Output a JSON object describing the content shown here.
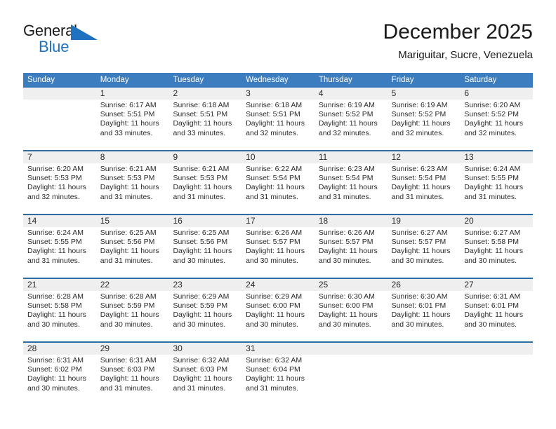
{
  "brand": {
    "name_top": "General",
    "name_bottom": "Blue",
    "mark": "triangle-logo",
    "color_top": "#1a1a1a",
    "color_bottom": "#1f72c0",
    "mark_color": "#1f72c0"
  },
  "header": {
    "title": "December 2025",
    "subtitle": "Mariguitar, Sucre, Venezuela"
  },
  "theme": {
    "header_bg": "#3b7dbf",
    "header_text": "#ffffff",
    "week_divider": "#2e6da4",
    "daynum_band": "#efefef",
    "body_text": "#2a2a2a"
  },
  "weekdays": [
    "Sunday",
    "Monday",
    "Tuesday",
    "Wednesday",
    "Thursday",
    "Friday",
    "Saturday"
  ],
  "weeks": [
    {
      "days": [
        {
          "date": "",
          "sunrise": "",
          "sunset": "",
          "daylight_1": "",
          "daylight_2": "",
          "empty": true
        },
        {
          "date": "1",
          "sunrise": "Sunrise: 6:17 AM",
          "sunset": "Sunset: 5:51 PM",
          "daylight_1": "Daylight: 11 hours",
          "daylight_2": "and 33 minutes."
        },
        {
          "date": "2",
          "sunrise": "Sunrise: 6:18 AM",
          "sunset": "Sunset: 5:51 PM",
          "daylight_1": "Daylight: 11 hours",
          "daylight_2": "and 33 minutes."
        },
        {
          "date": "3",
          "sunrise": "Sunrise: 6:18 AM",
          "sunset": "Sunset: 5:51 PM",
          "daylight_1": "Daylight: 11 hours",
          "daylight_2": "and 32 minutes."
        },
        {
          "date": "4",
          "sunrise": "Sunrise: 6:19 AM",
          "sunset": "Sunset: 5:52 PM",
          "daylight_1": "Daylight: 11 hours",
          "daylight_2": "and 32 minutes."
        },
        {
          "date": "5",
          "sunrise": "Sunrise: 6:19 AM",
          "sunset": "Sunset: 5:52 PM",
          "daylight_1": "Daylight: 11 hours",
          "daylight_2": "and 32 minutes."
        },
        {
          "date": "6",
          "sunrise": "Sunrise: 6:20 AM",
          "sunset": "Sunset: 5:52 PM",
          "daylight_1": "Daylight: 11 hours",
          "daylight_2": "and 32 minutes."
        }
      ]
    },
    {
      "days": [
        {
          "date": "7",
          "sunrise": "Sunrise: 6:20 AM",
          "sunset": "Sunset: 5:53 PM",
          "daylight_1": "Daylight: 11 hours",
          "daylight_2": "and 32 minutes."
        },
        {
          "date": "8",
          "sunrise": "Sunrise: 6:21 AM",
          "sunset": "Sunset: 5:53 PM",
          "daylight_1": "Daylight: 11 hours",
          "daylight_2": "and 31 minutes."
        },
        {
          "date": "9",
          "sunrise": "Sunrise: 6:21 AM",
          "sunset": "Sunset: 5:53 PM",
          "daylight_1": "Daylight: 11 hours",
          "daylight_2": "and 31 minutes."
        },
        {
          "date": "10",
          "sunrise": "Sunrise: 6:22 AM",
          "sunset": "Sunset: 5:54 PM",
          "daylight_1": "Daylight: 11 hours",
          "daylight_2": "and 31 minutes."
        },
        {
          "date": "11",
          "sunrise": "Sunrise: 6:23 AM",
          "sunset": "Sunset: 5:54 PM",
          "daylight_1": "Daylight: 11 hours",
          "daylight_2": "and 31 minutes."
        },
        {
          "date": "12",
          "sunrise": "Sunrise: 6:23 AM",
          "sunset": "Sunset: 5:54 PM",
          "daylight_1": "Daylight: 11 hours",
          "daylight_2": "and 31 minutes."
        },
        {
          "date": "13",
          "sunrise": "Sunrise: 6:24 AM",
          "sunset": "Sunset: 5:55 PM",
          "daylight_1": "Daylight: 11 hours",
          "daylight_2": "and 31 minutes."
        }
      ]
    },
    {
      "days": [
        {
          "date": "14",
          "sunrise": "Sunrise: 6:24 AM",
          "sunset": "Sunset: 5:55 PM",
          "daylight_1": "Daylight: 11 hours",
          "daylight_2": "and 31 minutes."
        },
        {
          "date": "15",
          "sunrise": "Sunrise: 6:25 AM",
          "sunset": "Sunset: 5:56 PM",
          "daylight_1": "Daylight: 11 hours",
          "daylight_2": "and 31 minutes."
        },
        {
          "date": "16",
          "sunrise": "Sunrise: 6:25 AM",
          "sunset": "Sunset: 5:56 PM",
          "daylight_1": "Daylight: 11 hours",
          "daylight_2": "and 30 minutes."
        },
        {
          "date": "17",
          "sunrise": "Sunrise: 6:26 AM",
          "sunset": "Sunset: 5:57 PM",
          "daylight_1": "Daylight: 11 hours",
          "daylight_2": "and 30 minutes."
        },
        {
          "date": "18",
          "sunrise": "Sunrise: 6:26 AM",
          "sunset": "Sunset: 5:57 PM",
          "daylight_1": "Daylight: 11 hours",
          "daylight_2": "and 30 minutes."
        },
        {
          "date": "19",
          "sunrise": "Sunrise: 6:27 AM",
          "sunset": "Sunset: 5:57 PM",
          "daylight_1": "Daylight: 11 hours",
          "daylight_2": "and 30 minutes."
        },
        {
          "date": "20",
          "sunrise": "Sunrise: 6:27 AM",
          "sunset": "Sunset: 5:58 PM",
          "daylight_1": "Daylight: 11 hours",
          "daylight_2": "and 30 minutes."
        }
      ]
    },
    {
      "days": [
        {
          "date": "21",
          "sunrise": "Sunrise: 6:28 AM",
          "sunset": "Sunset: 5:58 PM",
          "daylight_1": "Daylight: 11 hours",
          "daylight_2": "and 30 minutes."
        },
        {
          "date": "22",
          "sunrise": "Sunrise: 6:28 AM",
          "sunset": "Sunset: 5:59 PM",
          "daylight_1": "Daylight: 11 hours",
          "daylight_2": "and 30 minutes."
        },
        {
          "date": "23",
          "sunrise": "Sunrise: 6:29 AM",
          "sunset": "Sunset: 5:59 PM",
          "daylight_1": "Daylight: 11 hours",
          "daylight_2": "and 30 minutes."
        },
        {
          "date": "24",
          "sunrise": "Sunrise: 6:29 AM",
          "sunset": "Sunset: 6:00 PM",
          "daylight_1": "Daylight: 11 hours",
          "daylight_2": "and 30 minutes."
        },
        {
          "date": "25",
          "sunrise": "Sunrise: 6:30 AM",
          "sunset": "Sunset: 6:00 PM",
          "daylight_1": "Daylight: 11 hours",
          "daylight_2": "and 30 minutes."
        },
        {
          "date": "26",
          "sunrise": "Sunrise: 6:30 AM",
          "sunset": "Sunset: 6:01 PM",
          "daylight_1": "Daylight: 11 hours",
          "daylight_2": "and 30 minutes."
        },
        {
          "date": "27",
          "sunrise": "Sunrise: 6:31 AM",
          "sunset": "Sunset: 6:01 PM",
          "daylight_1": "Daylight: 11 hours",
          "daylight_2": "and 30 minutes."
        }
      ]
    },
    {
      "days": [
        {
          "date": "28",
          "sunrise": "Sunrise: 6:31 AM",
          "sunset": "Sunset: 6:02 PM",
          "daylight_1": "Daylight: 11 hours",
          "daylight_2": "and 30 minutes."
        },
        {
          "date": "29",
          "sunrise": "Sunrise: 6:31 AM",
          "sunset": "Sunset: 6:03 PM",
          "daylight_1": "Daylight: 11 hours",
          "daylight_2": "and 31 minutes."
        },
        {
          "date": "30",
          "sunrise": "Sunrise: 6:32 AM",
          "sunset": "Sunset: 6:03 PM",
          "daylight_1": "Daylight: 11 hours",
          "daylight_2": "and 31 minutes."
        },
        {
          "date": "31",
          "sunrise": "Sunrise: 6:32 AM",
          "sunset": "Sunset: 6:04 PM",
          "daylight_1": "Daylight: 11 hours",
          "daylight_2": "and 31 minutes."
        },
        {
          "date": "",
          "sunrise": "",
          "sunset": "",
          "daylight_1": "",
          "daylight_2": "",
          "empty": true
        },
        {
          "date": "",
          "sunrise": "",
          "sunset": "",
          "daylight_1": "",
          "daylight_2": "",
          "empty": true
        },
        {
          "date": "",
          "sunrise": "",
          "sunset": "",
          "daylight_1": "",
          "daylight_2": "",
          "empty": true
        }
      ]
    }
  ]
}
